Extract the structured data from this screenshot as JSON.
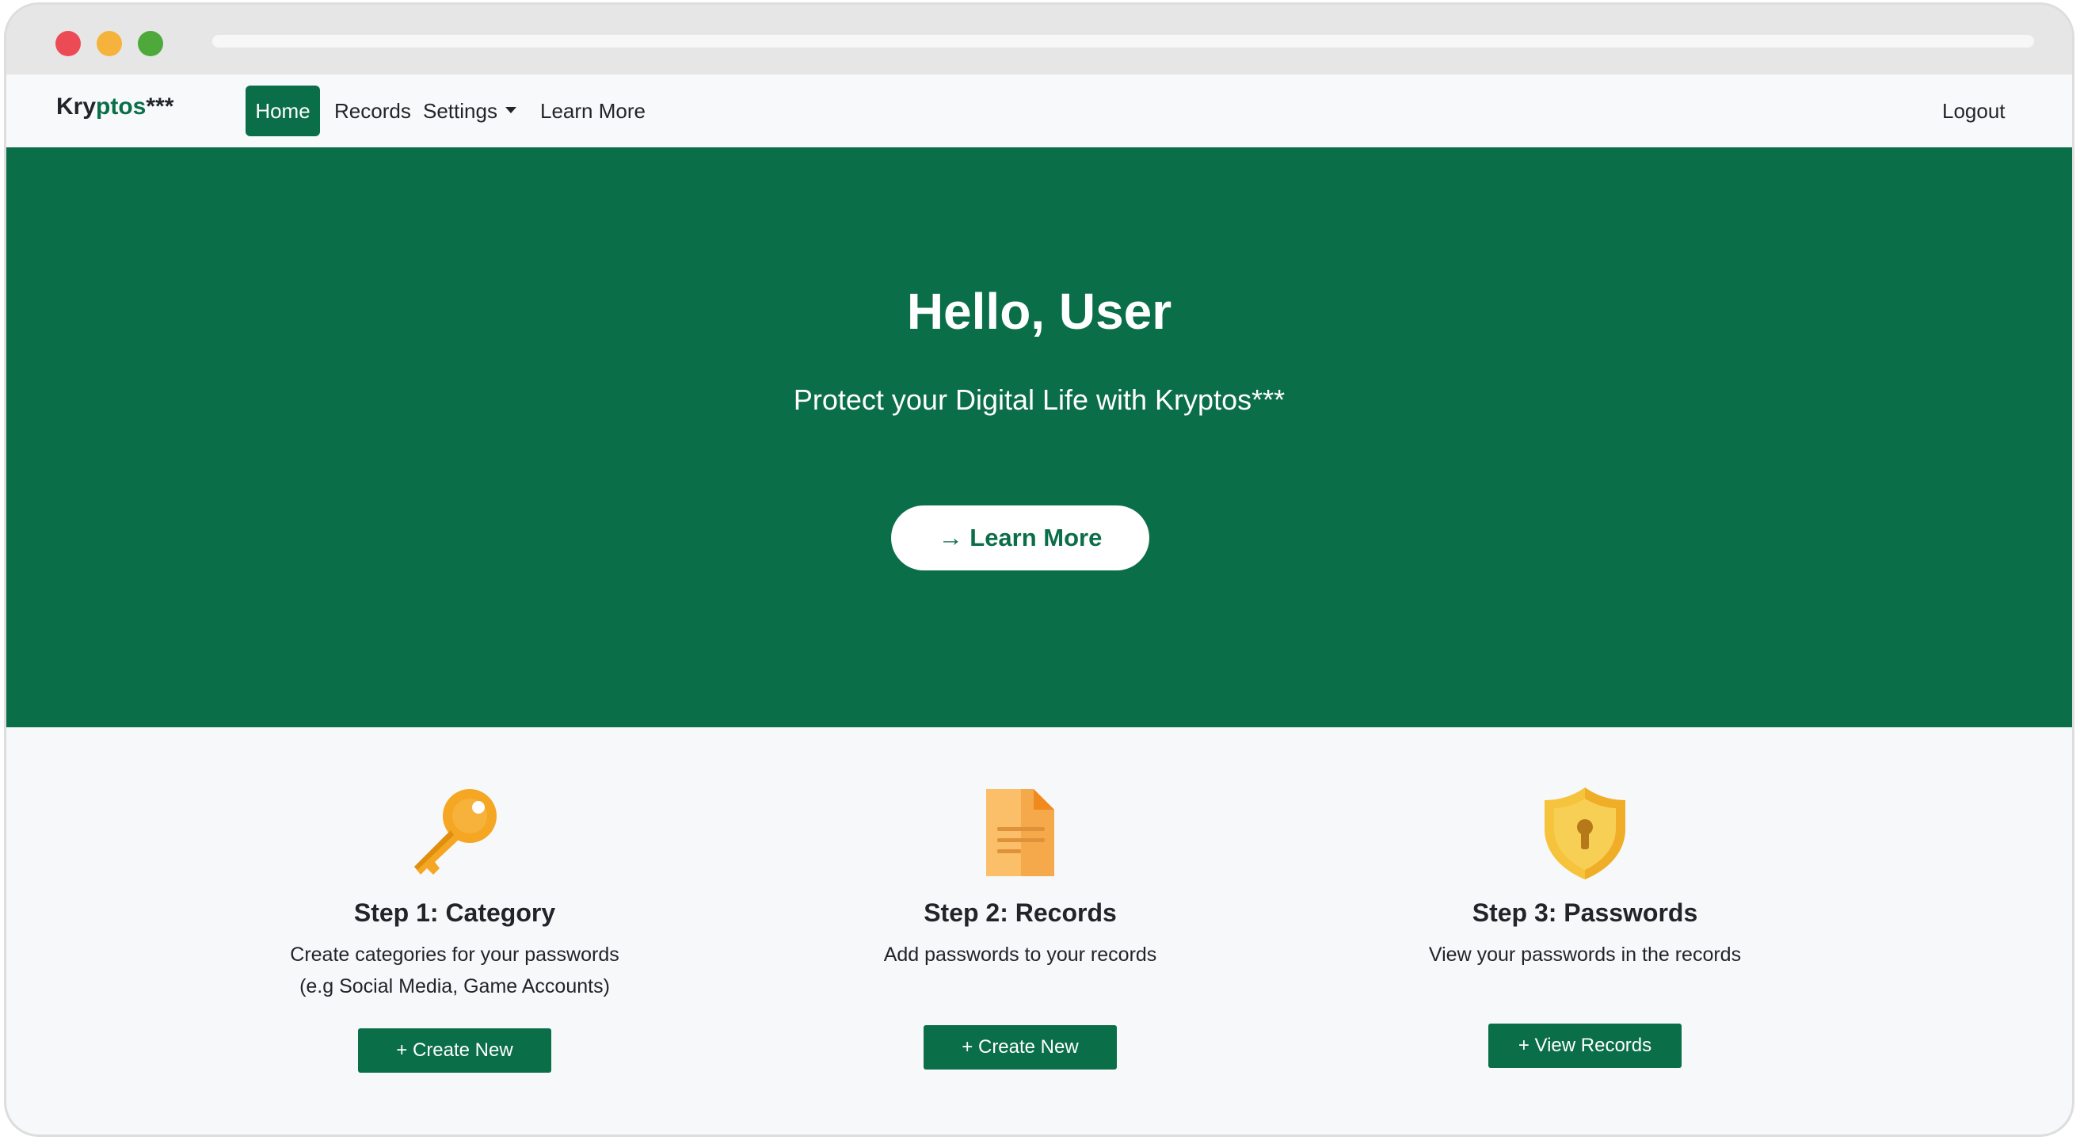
{
  "navbar": {
    "brand_prefix": "Kry",
    "brand_accent": "ptos",
    "brand_suffix": "***",
    "items": [
      {
        "label": "Home",
        "active": true
      },
      {
        "label": "Records"
      },
      {
        "label": "Settings"
      },
      {
        "label": "Learn More"
      }
    ],
    "logout_label": "Logout"
  },
  "hero": {
    "title": "Hello, User",
    "subtitle": "Protect your Digital Life with Kryptos***",
    "button_label": "→ Learn More"
  },
  "steps": [
    {
      "icon": "key-icon",
      "title": "Step 1: Category",
      "desc_line1": "Create categories for your passwords",
      "desc_line2": "(e.g Social Media, Game Accounts)",
      "button_label": "+ Create New"
    },
    {
      "icon": "document-icon",
      "title": "Step 2: Records",
      "desc_line1": "Add passwords to your records",
      "button_label": "+ Create New"
    },
    {
      "icon": "shield-lock-icon",
      "title": "Step 3: Passwords",
      "desc_line1": "View your passwords in the records",
      "button_label": "+ View Records"
    }
  ],
  "colors": {
    "primary": "#0a6e48",
    "icon_orange": "#f5a623",
    "icon_yellow": "#f6c33c"
  }
}
